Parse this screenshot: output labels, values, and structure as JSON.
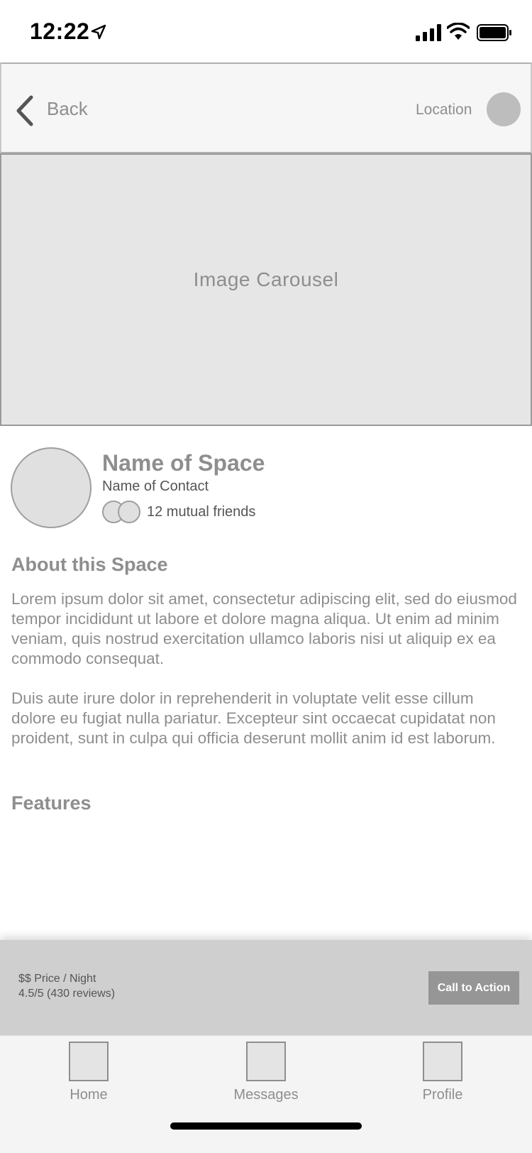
{
  "status_bar": {
    "time": "12:22"
  },
  "header": {
    "back_label": "Back",
    "location_label": "Location"
  },
  "carousel": {
    "label": "Image Carousel"
  },
  "listing": {
    "space_name": "Name of Space",
    "contact_name": "Name of Contact",
    "mutual_friends": "12 mutual friends"
  },
  "about": {
    "title": "About this Space",
    "paragraph1": "Lorem ipsum dolor sit amet, consectetur adipiscing elit, sed do eiusmod tempor incididunt ut labore et dolore magna aliqua. Ut enim ad minim veniam, quis nostrud exercitation ullamco laboris nisi ut aliquip ex ea commodo consequat.",
    "paragraph2": "Duis aute irure dolor in reprehenderit in voluptate velit esse cillum dolore eu fugiat nulla pariatur. Excepteur sint occaecat cupidatat non proident, sunt in culpa qui officia deserunt mollit anim id est laborum."
  },
  "features": {
    "title": "Features"
  },
  "booking": {
    "price": "$$ Price / Night",
    "rating": "4.5/5 (430 reviews)",
    "cta_label": "Call to Action"
  },
  "tabs": [
    {
      "label": "Home",
      "icon": "home-icon"
    },
    {
      "label": "Messages",
      "icon": "messages-icon"
    },
    {
      "label": "Profile",
      "icon": "profile-icon"
    }
  ]
}
